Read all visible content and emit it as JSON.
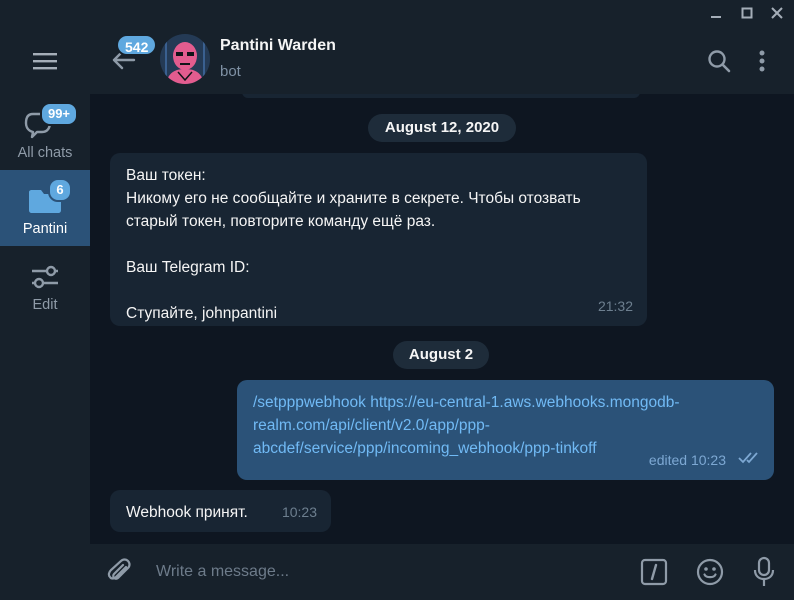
{
  "sidebar": {
    "folders": [
      {
        "label": "All chats",
        "badge": "99+",
        "icon": "chat-bubbles-icon"
      },
      {
        "label": "Pantini",
        "badge": "6",
        "icon": "folder-icon",
        "active": true
      },
      {
        "label": "Edit",
        "icon": "sliders-icon"
      }
    ]
  },
  "header": {
    "unread_count": "542",
    "name": "Pantini Warden",
    "status": "bot",
    "avatar_color": "#e35c8f"
  },
  "messages": [
    {
      "type": "date",
      "text": "August 12, 2020"
    },
    {
      "type": "incoming",
      "lines": [
        "Ваш токен:",
        "Никому его не сообщайте и храните в секрете. Чтобы отозвать",
        "старый токен, повторите команду ещё раз.",
        "",
        "Ваш Telegram ID:",
        "",
        "Ступайте, johnpantini"
      ],
      "time": "21:32"
    },
    {
      "type": "date",
      "text": "August 2"
    },
    {
      "type": "outgoing",
      "lines": [
        "/setpppwebhook https://eu-central-1.aws.webhooks.mongodb-",
        "realm.com/api/client/v2.0/app/ppp-",
        "abcdef/service/ppp/incoming_webhook/ppp-tinkoff"
      ],
      "time": "edited 10:23",
      "read": true
    },
    {
      "type": "incoming",
      "lines": [
        "Webhook принят."
      ],
      "time": "10:23"
    }
  ],
  "composer": {
    "placeholder": "Write a message..."
  },
  "colors": {
    "accent": "#5fa8df",
    "outgoing_bubble": "#2b5278",
    "incoming_bubble": "#182533",
    "background": "#0e1621"
  }
}
